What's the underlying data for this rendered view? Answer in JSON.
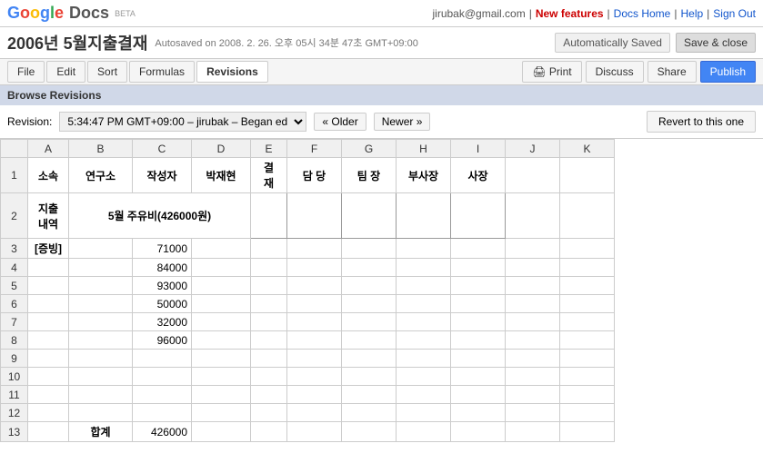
{
  "header": {
    "logo_google": "Google",
    "logo_docs": "Docs",
    "logo_beta": "BETA",
    "user_email": "jirubak@gmail.com",
    "sep1": "|",
    "new_features_label": "New features",
    "sep2": "|",
    "docs_home_label": "Docs Home",
    "sep3": "|",
    "help_label": "Help",
    "sep4": "|",
    "sign_out_label": "Sign Out"
  },
  "title_bar": {
    "doc_title": "2006년 5월지출결재",
    "autosaved_info": "Autosaved on 2008. 2. 26. 오후 05시 34분 47초 GMT+09:00",
    "auto_saved_badge": "Automatically Saved",
    "save_close": "Save & close"
  },
  "toolbar": {
    "file_label": "File",
    "edit_label": "Edit",
    "sort_label": "Sort",
    "formulas_label": "Formulas",
    "revisions_label": "Revisions",
    "print_label": "Print",
    "discuss_label": "Discuss",
    "share_label": "Share",
    "publish_label": "Publish"
  },
  "browse_revisions": {
    "label": "Browse Revisions"
  },
  "revision_selector": {
    "label": "Revision:",
    "value": "5:34:47 PM GMT+09:00 – jirubak – Began ed",
    "older_label": "« Older",
    "newer_label": "Newer »",
    "revert_label": "Revert to this one"
  },
  "spreadsheet": {
    "col_headers": [
      "",
      "A",
      "B",
      "C",
      "D",
      "E",
      "F",
      "G",
      "H",
      "I",
      "J",
      "K"
    ],
    "header_row": {
      "cells": [
        "소속",
        "연구소",
        "작성자",
        "박재현",
        "결\n재",
        "담 당",
        "팀 장",
        "부사장",
        "사장",
        "",
        ""
      ]
    },
    "rows": [
      {
        "row_num": "1",
        "label": "지출\n내역",
        "cells": [
          "",
          "5월 주유비(426000원)",
          "",
          "",
          "",
          "",
          "",
          "",
          "",
          ""
        ]
      },
      {
        "row_num": "2",
        "label": "[증빙]",
        "cells": [
          "",
          "",
          "71000",
          "",
          "",
          "",
          "",
          "",
          "",
          ""
        ]
      },
      {
        "row_num": "3",
        "label": "",
        "cells": [
          "",
          "",
          "84000",
          "",
          "",
          "",
          "",
          "",
          "",
          ""
        ]
      },
      {
        "row_num": "4",
        "label": "",
        "cells": [
          "",
          "",
          "93000",
          "",
          "",
          "",
          "",
          "",
          "",
          ""
        ]
      },
      {
        "row_num": "5",
        "label": "",
        "cells": [
          "",
          "",
          "50000",
          "",
          "",
          "",
          "",
          "",
          "",
          ""
        ]
      },
      {
        "row_num": "6",
        "label": "",
        "cells": [
          "",
          "",
          "32000",
          "",
          "",
          "",
          "",
          "",
          "",
          ""
        ]
      },
      {
        "row_num": "7",
        "label": "",
        "cells": [
          "",
          "",
          "96000",
          "",
          "",
          "",
          "",
          "",
          "",
          ""
        ]
      },
      {
        "row_num": "8",
        "label": "",
        "cells": [
          "",
          "",
          "",
          "",
          "",
          "",
          "",
          "",
          "",
          ""
        ]
      },
      {
        "row_num": "9",
        "label": "",
        "cells": [
          "",
          "",
          "",
          "",
          "",
          "",
          "",
          "",
          "",
          ""
        ]
      },
      {
        "row_num": "10",
        "label": "",
        "cells": [
          "",
          "",
          "",
          "",
          "",
          "",
          "",
          "",
          "",
          ""
        ]
      },
      {
        "row_num": "11",
        "label": "",
        "cells": [
          "",
          "",
          "",
          "",
          "",
          "",
          "",
          "",
          "",
          ""
        ]
      },
      {
        "row_num": "12",
        "label": "합계",
        "cells": [
          "",
          "",
          "426000",
          "",
          "",
          "",
          "",
          "",
          "",
          ""
        ]
      }
    ]
  }
}
